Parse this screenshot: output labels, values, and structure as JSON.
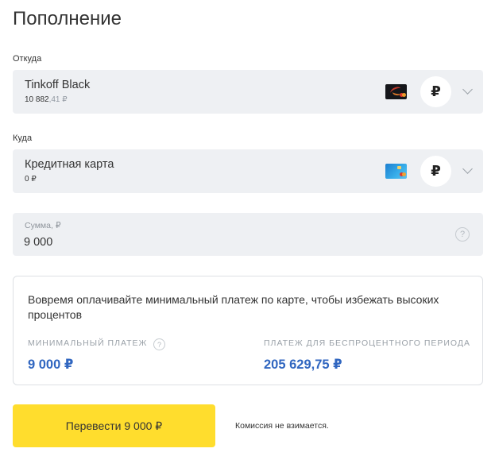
{
  "page": {
    "title": "Пополнение"
  },
  "from": {
    "label": "Откуда",
    "account_name": "Tinkoff Black",
    "balance_main": "10 882",
    "balance_kop": ",41 ₽",
    "card_icon": "black-card-icon",
    "currency": "₽"
  },
  "to": {
    "label": "Куда",
    "account_name": "Кредитная карта",
    "balance": "0 ₽",
    "card_icon": "blue-card-icon",
    "currency": "₽"
  },
  "amount": {
    "label": "Сумма, ₽",
    "value": "9 000",
    "help": "?"
  },
  "info": {
    "text": "Вовремя оплачивайте минимальный платеж по карте, чтобы избежать высоких процентов",
    "min_payment_label": "МИНИМАЛЬНЫЙ ПЛАТЕЖ",
    "min_payment_value": "9 000 ₽",
    "grace_payment_label": "ПЛАТЕЖ ДЛЯ БЕСПРОЦЕНТНОГО ПЕРИОДА",
    "grace_payment_value": "205 629,75 ₽",
    "help": "?"
  },
  "actions": {
    "transfer_label": "Перевести 9 000 ₽",
    "commission_note": "Комиссия не взимается."
  },
  "colors": {
    "accent_yellow": "#ffdd2d",
    "value_blue": "#3066c0",
    "field_bg": "#eef0f3"
  }
}
